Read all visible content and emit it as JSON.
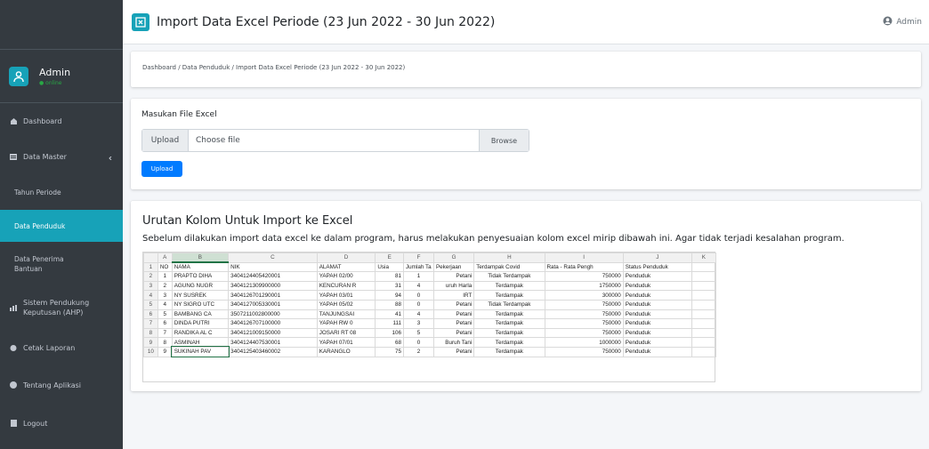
{
  "header": {
    "title": "Import Data Excel Periode (23 Jun 2022 - 30 Jun 2022)",
    "user_label": "Admin"
  },
  "sidebar": {
    "user": {
      "name": "Admin",
      "status": "online"
    },
    "items": [
      {
        "label": "Dashboard",
        "icon": "dashboard-icon"
      },
      {
        "label": "Data Master",
        "icon": "database-icon"
      },
      {
        "label": "Tahun Periode"
      },
      {
        "label": "Data Penduduk"
      },
      {
        "label": "Data Penerima Bantuan"
      },
      {
        "label": "Sistem Pendukung Keputusan (AHP)",
        "icon": "chart-icon"
      },
      {
        "label": "Cetak Laporan",
        "icon": "print-icon"
      },
      {
        "label": "Tentang Aplikasi",
        "icon": "info-icon"
      },
      {
        "label": "Logout",
        "icon": "logout-icon"
      }
    ]
  },
  "breadcrumb": "Dashboard / Data Penduduk / Import Data Excel Periode (23 Jun 2022 - 30 Jun 2022)",
  "upload_form": {
    "label": "Masukan File Excel",
    "prepend": "Upload",
    "placeholder": "Choose file",
    "browse": "Browse",
    "submit": "Upload"
  },
  "import_guide": {
    "title": "Urutan Kolom Untuk Import ke Excel",
    "description": "Sebelum dilakukan import data excel ke dalam program, harus melakukan penyesuaian kolom excel mirip dibawah ini. Agar tidak terjadi kesalahan program."
  },
  "excel": {
    "col_letters": [
      "A",
      "B",
      "C",
      "D",
      "E",
      "F",
      "G",
      "H",
      "I",
      "J",
      "K"
    ],
    "rows": [
      [
        "NO",
        "NAMA",
        "NIK",
        "ALAMAT",
        "Usia",
        "Jumlah Ta",
        "Pekerjaan",
        "Terdampak Covid",
        "Rata - Rata Pengh",
        "Status Penduduk",
        ""
      ],
      [
        "1",
        "PRAPTO DIHA",
        "3404124405420001",
        "YAPAH 02/00",
        "81",
        "1",
        "Petani",
        "Tidak Terdampak",
        "750000",
        "Penduduk",
        ""
      ],
      [
        "2",
        "AGUNG NUGR",
        "3404121309900000",
        "KENCURAN R",
        "31",
        "4",
        "uruh Harla",
        "Terdampak",
        "1750000",
        "Penduduk",
        ""
      ],
      [
        "3",
        "NY SUSREK",
        "3404126701290001",
        "YAPAH 03/01",
        "94",
        "0",
        "IRT",
        "Terdampak",
        "300000",
        "Penduduk",
        ""
      ],
      [
        "4",
        "NY SIGRO UTC",
        "3404127005330001",
        "YAPAH 05/02",
        "88",
        "0",
        "Petani",
        "Tidak Terdampak",
        "750000",
        "Penduduk",
        ""
      ],
      [
        "5",
        "BAMBANG CA",
        "3507211002800000",
        "TANJUNGSAI",
        "41",
        "4",
        "Petani",
        "Terdampak",
        "750000",
        "Penduduk",
        ""
      ],
      [
        "6",
        "DINDA PUTRI",
        "3404126707100000",
        "YAPAH RW 0",
        "111",
        "3",
        "Petani",
        "Terdampak",
        "750000",
        "Penduduk",
        ""
      ],
      [
        "7",
        "RANDIKA AL C",
        "3404121009150000",
        "JOSARI RT 08",
        "106",
        "5",
        "Petani",
        "Terdampak",
        "750000",
        "Penduduk",
        ""
      ],
      [
        "8",
        "ASMINAH",
        "3404124407530001",
        "YAPAH 07/01",
        "68",
        "0",
        "Buruh Tani",
        "Terdampak",
        "1000000",
        "Penduduk",
        ""
      ],
      [
        "9",
        "SUKINAH PAV",
        "3404125403460002",
        "KARANGLO",
        "75",
        "2",
        "Petani",
        "Terdampak",
        "750000",
        "Penduduk",
        ""
      ]
    ]
  }
}
